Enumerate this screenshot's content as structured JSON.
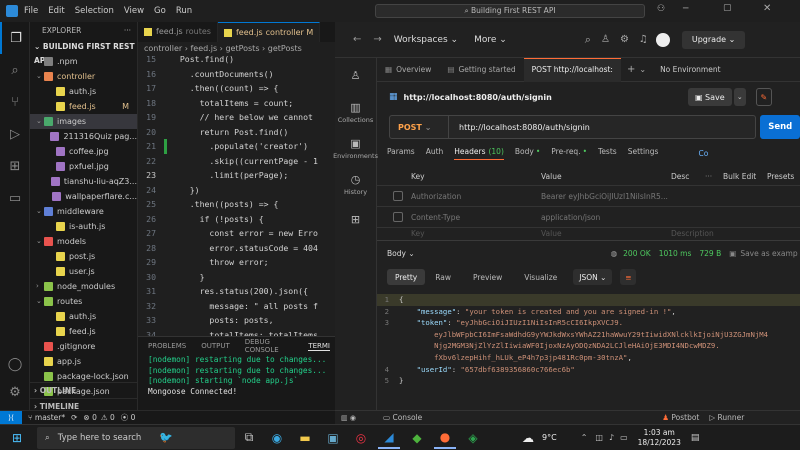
{
  "vscode": {
    "menu": [
      "File",
      "Edit",
      "Selection",
      "View",
      "Go",
      "Run"
    ],
    "explorer": {
      "header": "EXPLORER",
      "more": "···",
      "project": "BUILDING FIRST REST API",
      "items": [
        {
          "label": ".npm",
          "kind": "folder",
          "depth": 1,
          "open": false,
          "color": "#7f7f7f"
        },
        {
          "label": "controller",
          "kind": "folder",
          "depth": 1,
          "open": true,
          "color": "#e8834e",
          "modified": true
        },
        {
          "label": "auth.js",
          "kind": "js",
          "depth": 2,
          "color": "#e8d44d"
        },
        {
          "label": "feed.js",
          "kind": "js",
          "depth": 2,
          "color": "#e8d44d",
          "badge": "M",
          "modified": true
        },
        {
          "label": "images",
          "kind": "folder",
          "depth": 1,
          "open": true,
          "color": "#4aa96c",
          "selected": true
        },
        {
          "label": "211316Quiz pag...",
          "kind": "img",
          "depth": 2,
          "color": "#a074c4"
        },
        {
          "label": "coffee.jpg",
          "kind": "img",
          "depth": 2,
          "color": "#a074c4"
        },
        {
          "label": "pxfuel.jpg",
          "kind": "img",
          "depth": 2,
          "color": "#a074c4"
        },
        {
          "label": "tianshu-liu-aqZ3...",
          "kind": "img",
          "depth": 2,
          "color": "#a074c4"
        },
        {
          "label": "wallpaperflare.c...",
          "kind": "img",
          "depth": 2,
          "color": "#a074c4"
        },
        {
          "label": "middleware",
          "kind": "folder",
          "depth": 1,
          "open": true,
          "color": "#5f7fd6"
        },
        {
          "label": "is-auth.js",
          "kind": "js",
          "depth": 2,
          "color": "#e8d44d"
        },
        {
          "label": "models",
          "kind": "folder",
          "depth": 1,
          "open": true,
          "color": "#e8534e"
        },
        {
          "label": "post.js",
          "kind": "js",
          "depth": 2,
          "color": "#e8d44d"
        },
        {
          "label": "user.js",
          "kind": "js",
          "depth": 2,
          "color": "#e8d44d"
        },
        {
          "label": "node_modules",
          "kind": "folder",
          "depth": 1,
          "open": false,
          "color": "#8bc34a"
        },
        {
          "label": "routes",
          "kind": "folder",
          "depth": 1,
          "open": true,
          "color": "#8bc34a"
        },
        {
          "label": "auth.js",
          "kind": "js",
          "depth": 2,
          "color": "#e8d44d"
        },
        {
          "label": "feed.js",
          "kind": "js",
          "depth": 2,
          "color": "#e8d44d"
        },
        {
          "label": ".gitignore",
          "kind": "git",
          "depth": 1,
          "color": "#e8534e"
        },
        {
          "label": "app.js",
          "kind": "js",
          "depth": 1,
          "color": "#e8d44d"
        },
        {
          "label": "package-lock.json",
          "kind": "json",
          "depth": 1,
          "color": "#8bc34a"
        },
        {
          "label": "package.json",
          "kind": "json",
          "depth": 1,
          "color": "#8bc34a"
        }
      ],
      "sections": [
        "OUTLINE",
        "TIMELINE"
      ]
    },
    "tabs": [
      {
        "label": "feed.js",
        "suffix": "routes",
        "active": false
      },
      {
        "label": "feed.js",
        "suffix": "controller M",
        "active": true
      }
    ],
    "breadcrumb": [
      "controller",
      "feed.js",
      "getPosts",
      "getPosts"
    ],
    "code": [
      {
        "n": "15",
        "text": "  Post.find()"
      },
      {
        "n": "16",
        "text": "    .countDocuments()"
      },
      {
        "n": "17",
        "text": "    .then((count) => {"
      },
      {
        "n": "18",
        "text": "      totalItems = count;"
      },
      {
        "n": "19",
        "text": "      // here below we cannot"
      },
      {
        "n": "20",
        "text": "      return Post.find()"
      },
      {
        "n": "21",
        "text": "        .populate('creator')",
        "added": true
      },
      {
        "n": "22",
        "text": "        .skip((currentPage - 1"
      },
      {
        "n": "23",
        "text": "        .limit(perPage);",
        "current": true
      },
      {
        "n": "24",
        "text": "    })"
      },
      {
        "n": "25",
        "text": "    .then((posts) => {"
      },
      {
        "n": "26",
        "text": "      if (!posts) {"
      },
      {
        "n": "27",
        "text": "        const error = new Erro"
      },
      {
        "n": "28",
        "text": "        error.statusCode = 404"
      },
      {
        "n": "29",
        "text": "        throw error;"
      },
      {
        "n": "30",
        "text": "      }"
      },
      {
        "n": "31",
        "text": "      res.status(200).json({"
      },
      {
        "n": "32",
        "text": "        message: \" all posts f"
      },
      {
        "n": "33",
        "text": "        posts: posts,"
      },
      {
        "n": "34",
        "text": "        totalItems: totalItems"
      },
      {
        "n": "35",
        "text": "      });"
      },
      {
        "n": "36",
        "text": "    })"
      },
      {
        "n": "37",
        "text": "    .catch((err) => {"
      }
    ],
    "panel_tabs": [
      "PROBLEMS",
      "OUTPUT",
      "DEBUG CONSOLE",
      "TERMI"
    ],
    "terminal": [
      "[nodemon] restarting due to changes...",
      "[nodemon] restarting due to changes...",
      "[nodemon] starting `node app.js`",
      "Mongoose Connected!"
    ],
    "status": {
      "branch": "master*",
      "errors": "0",
      "warnings": "0",
      "ports": "0"
    }
  },
  "postman": {
    "search": "Building First REST API",
    "workspaces": "Workspaces",
    "more": "More",
    "upgrade": "Upgrade",
    "sidebar": [
      {
        "label": "",
        "icon": "user-icon"
      },
      {
        "label": "Collections",
        "icon": "trash-icon"
      },
      {
        "label": "Environments",
        "icon": "env-icon"
      },
      {
        "label": "History",
        "icon": "history-icon"
      },
      {
        "label": "",
        "icon": "grid-icon"
      }
    ],
    "tabs": [
      "Overview",
      "Getting started",
      "POST http://localhost:"
    ],
    "environment": "No Environment",
    "request_title": "http://localhost:8080/auth/signin",
    "save": "Save",
    "method": "POST",
    "url": "http://localhost:8080/auth/signin",
    "send": "Send",
    "req_tabs": [
      {
        "label": "Params"
      },
      {
        "label": "Auth"
      },
      {
        "label": "Headers",
        "count": "(10)",
        "active": true
      },
      {
        "label": "Body"
      },
      {
        "label": "Pre-req."
      },
      {
        "label": "Tests"
      },
      {
        "label": "Settings"
      }
    ],
    "req_tabs_cut": "Co",
    "headers_table": {
      "cols": [
        "Key",
        "Value",
        "Desc",
        "Bulk Edit",
        "Presets"
      ],
      "more": "···",
      "rows": [
        {
          "key": "Authorization",
          "value": "Bearer eyJhbGciOiJIUzI1NiIsInR5..."
        },
        {
          "key": "Content-Type",
          "value": "application/json"
        },
        {
          "key": "Key",
          "value": "Value",
          "desc": "Description"
        }
      ]
    },
    "response": {
      "label": "Body",
      "status": "200 OK",
      "time": "1010 ms",
      "size": "729 B",
      "save_as": "Save as examp",
      "views": [
        "Pretty",
        "Raw",
        "Preview",
        "Visualize"
      ],
      "format": "JSON",
      "lines": [
        {
          "n": "1",
          "parts": [
            {
              "t": "{",
              "c": "jp"
            }
          ]
        },
        {
          "n": "2",
          "parts": [
            {
              "t": "    ",
              "c": "jp"
            },
            {
              "t": "\"message\"",
              "c": "jk"
            },
            {
              "t": ": ",
              "c": "jp"
            },
            {
              "t": "\"your token is created and you are signed-in !\"",
              "c": "js"
            },
            {
              "t": ",",
              "c": "jp"
            }
          ]
        },
        {
          "n": "3",
          "parts": [
            {
              "t": "    ",
              "c": "jp"
            },
            {
              "t": "\"token\"",
              "c": "jk"
            },
            {
              "t": ": ",
              "c": "jp"
            },
            {
              "t": "\"eyJhbGciOiJIUzI1NiIsInR5cCI6IkpXVCJ9.",
              "c": "js"
            }
          ]
        },
        {
          "n": "",
          "parts": [
            {
              "t": "        eyJlbWFpbCI6ImFsaWdhdG9yYWJkdWxsYWhAZ21haWwuY29tIiwidXNlcklkIjoiNjU3ZGJmNjM4",
              "c": "js"
            }
          ]
        },
        {
          "n": "",
          "parts": [
            {
              "t": "        Njg2MGM3NjZlYzZlIiwiaWF0IjoxNzAyODQzNDA2LCJleHAiOjE3MDI4NDcwMDZ9.",
              "c": "js"
            }
          ]
        },
        {
          "n": "",
          "parts": [
            {
              "t": "        fXbv6lzepHihf_hLUk_eP4h7p3jp481Rc0pm-30tnzA\"",
              "c": "js"
            },
            {
              "t": ",",
              "c": "jp"
            }
          ]
        },
        {
          "n": "4",
          "parts": [
            {
              "t": "    ",
              "c": "jp"
            },
            {
              "t": "\"userId\"",
              "c": "jk"
            },
            {
              "t": ": ",
              "c": "jp"
            },
            {
              "t": "\"657dbf6389356860c766ec6b\"",
              "c": "js"
            }
          ]
        },
        {
          "n": "5",
          "parts": [
            {
              "t": "}",
              "c": "jp"
            }
          ]
        }
      ]
    },
    "footer": {
      "console": "Console",
      "postbot": "Postbot",
      "runner": "Runner"
    }
  },
  "taskbar": {
    "search": "Type here to search",
    "weather": "9°C",
    "time": "1:03 am",
    "date": "18/12/2023"
  }
}
